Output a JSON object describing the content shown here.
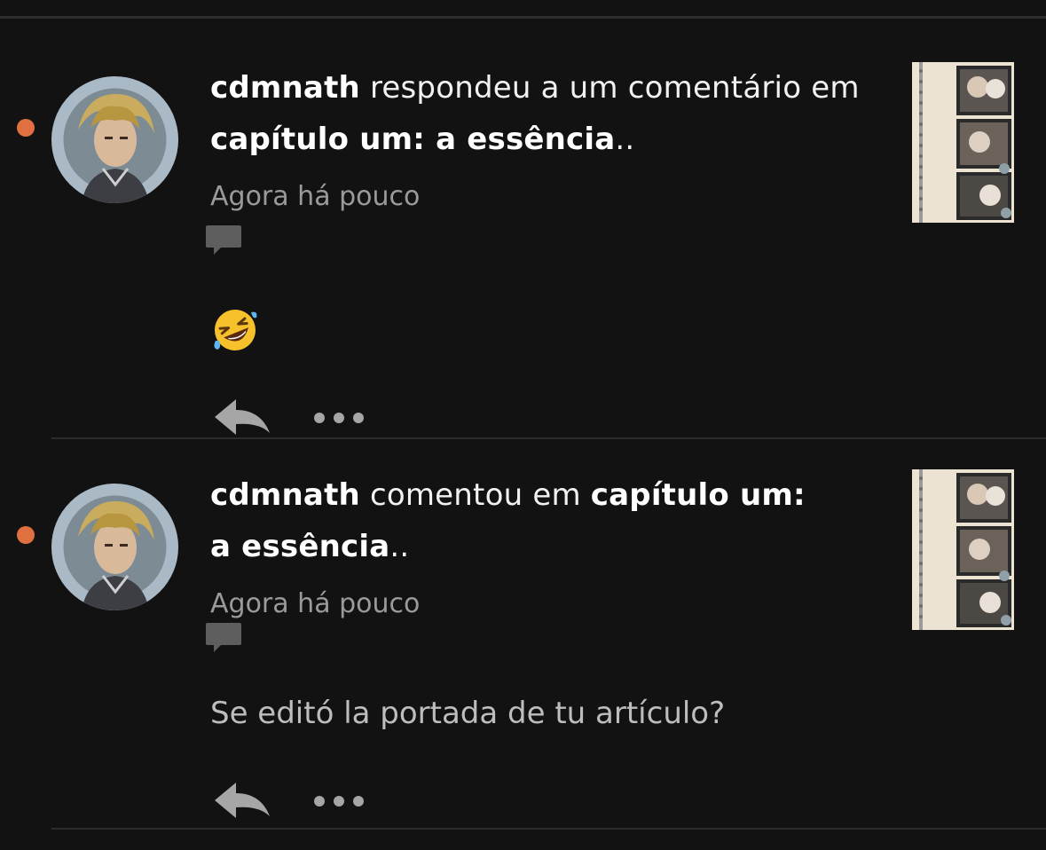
{
  "colors": {
    "background": "#121212",
    "unread_dot": "#e0703f",
    "divider": "#2c2c2c",
    "secondary_text": "#9a9a9a"
  },
  "notifications": [
    {
      "user": "cdmnath",
      "action": "respondeu a um comentário em",
      "story": "capítulo um: a essência",
      "story_suffix": "..",
      "time": "Agora há pouco",
      "content_type": "emoji",
      "content_emoji": "🤣",
      "icons": {
        "avatar": "avatar",
        "comment": "comment-bubble-icon",
        "reply": "reply-icon",
        "more": "more-options-icon",
        "thumbnail": "story-cover-thumbnail"
      }
    },
    {
      "user": "cdmnath",
      "action": "comentou em",
      "story": "capítulo um: a essência",
      "story_suffix": "..",
      "time": "Agora há pouco",
      "content_type": "text",
      "content_text": "Se editó la portada de tu artículo?",
      "icons": {
        "avatar": "avatar",
        "comment": "comment-bubble-icon",
        "reply": "reply-icon",
        "more": "more-options-icon",
        "thumbnail": "story-cover-thumbnail"
      }
    }
  ]
}
